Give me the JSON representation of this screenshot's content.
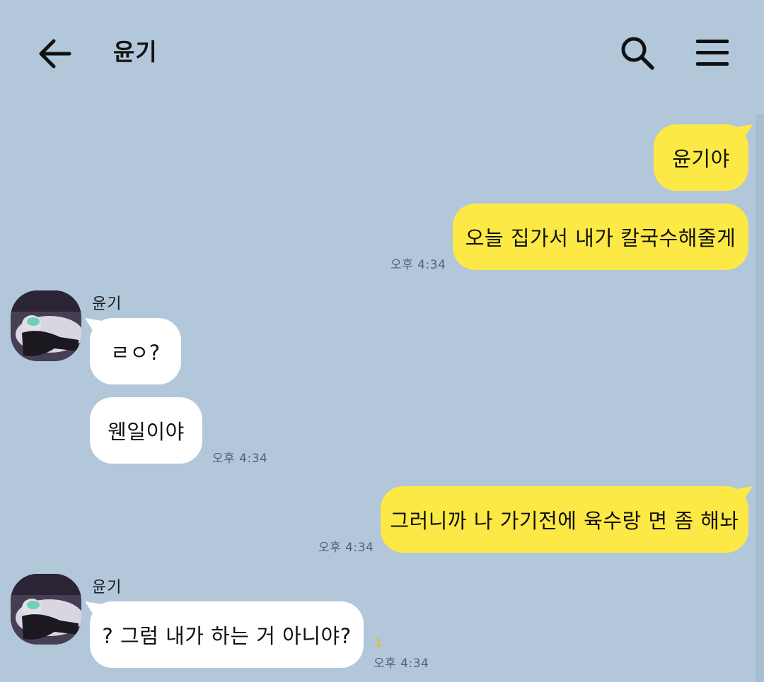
{
  "header": {
    "title": "윤기",
    "back_icon": "back-arrow-icon",
    "search_icon": "search-icon",
    "menu_icon": "hamburger-menu-icon"
  },
  "colors": {
    "background": "#b2c7da",
    "my_bubble": "#fde945",
    "their_bubble": "#ffffff",
    "timestamp": "#55626f"
  },
  "messages": [
    {
      "from": "me",
      "text": "윤기야"
    },
    {
      "from": "me",
      "text": "오늘 집가서 내가 칼국수해줄게",
      "time": "오후 4:34"
    },
    {
      "from": "them",
      "sender": "윤기",
      "text": "ㄹㅇ?"
    },
    {
      "from": "them",
      "text": "웬일이야",
      "time": "오후 4:34"
    },
    {
      "from": "me",
      "text": "그러니까 나 가기전에 육수랑 면 좀 해놔",
      "time": "오후 4:34"
    },
    {
      "from": "them",
      "sender": "윤기",
      "text": "? 그럼 내가 하는 거 아니야?",
      "unread": "1",
      "time": "오후 4:34"
    }
  ]
}
